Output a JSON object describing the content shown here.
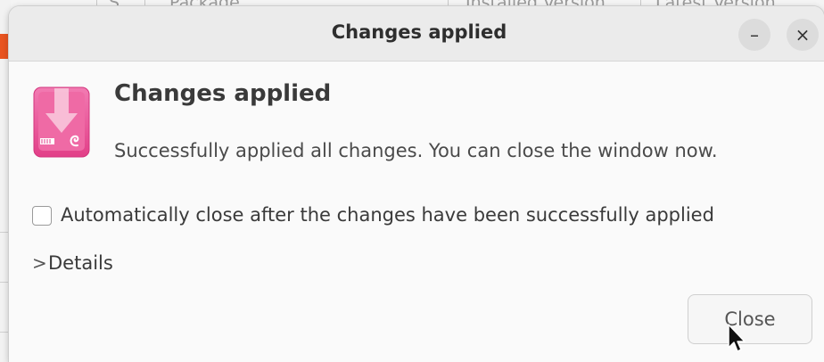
{
  "background": {
    "columns": [
      "S",
      "Package",
      "Installed Version",
      "Latest Version"
    ]
  },
  "dialog": {
    "title": "Changes applied",
    "minimize_glyph": "–",
    "close_glyph": "×",
    "heading": "Changes applied",
    "message": "Successfully applied all changes. You can close the window now.",
    "auto_close_label": "Automatically close after the changes have been successfully applied",
    "auto_close_checked": false,
    "details_arrow": ">",
    "details_label": "Details",
    "close_button_label": "Close",
    "icon": "package-install-icon",
    "accent_color": "#e84c92"
  }
}
